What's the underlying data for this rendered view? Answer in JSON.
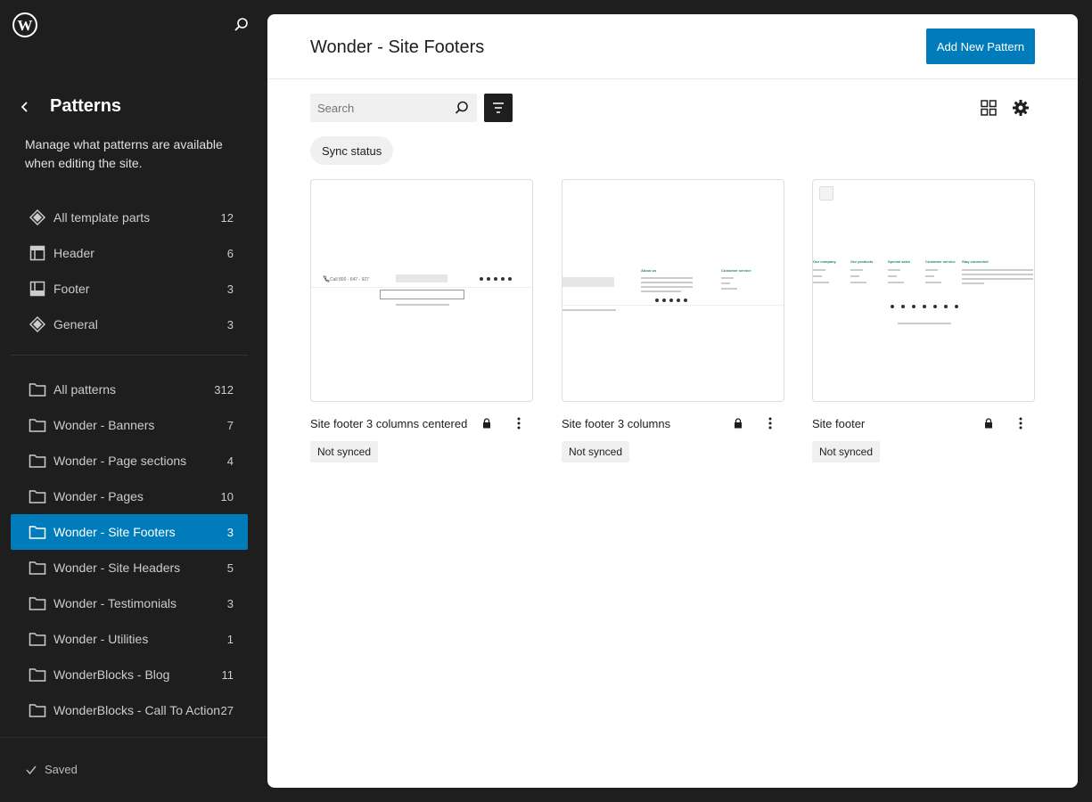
{
  "sidebar": {
    "logo_icon": "wordpress-logo-icon",
    "title": "Patterns",
    "description": "Manage what patterns are available when editing the site.",
    "template_parts": [
      {
        "label": "All template parts",
        "count": "12",
        "icon": "symbol-icon"
      },
      {
        "label": "Header",
        "count": "6",
        "icon": "header-icon"
      },
      {
        "label": "Footer",
        "count": "3",
        "icon": "footer-icon"
      },
      {
        "label": "General",
        "count": "3",
        "icon": "symbol-icon"
      }
    ],
    "categories": [
      {
        "label": "All patterns",
        "count": "312"
      },
      {
        "label": "Wonder - Banners",
        "count": "7"
      },
      {
        "label": "Wonder - Page sections",
        "count": "4"
      },
      {
        "label": "Wonder - Pages",
        "count": "10"
      },
      {
        "label": "Wonder - Site Footers",
        "count": "3",
        "active": true
      },
      {
        "label": "Wonder - Site Headers",
        "count": "5"
      },
      {
        "label": "Wonder - Testimonials",
        "count": "3"
      },
      {
        "label": "Wonder - Utilities",
        "count": "1"
      },
      {
        "label": "WonderBlocks - Blog",
        "count": "11"
      },
      {
        "label": "WonderBlocks - Call To Action",
        "count": "27"
      }
    ],
    "saved_label": "Saved"
  },
  "main": {
    "title": "Wonder - Site Footers",
    "add_button": "Add New Pattern",
    "search_placeholder": "Search",
    "filter_chip": "Sync status",
    "patterns": [
      {
        "title": "Site footer 3 columns centered",
        "status": "Not synced",
        "locked": true
      },
      {
        "title": "Site footer 3 columns",
        "status": "Not synced",
        "locked": true
      },
      {
        "title": "Site footer",
        "status": "Not synced",
        "locked": true
      }
    ]
  },
  "thumbs": {
    "t1_phone": "Call 800 - 647 - 927",
    "t2_about": "About us",
    "t2_service": "Customer service",
    "t3_cols": [
      "Our company",
      "Our products",
      "Special sales",
      "Customer service",
      "Stay connected"
    ]
  },
  "colors": {
    "accent": "#007cba",
    "sidebar_bg": "#1e1e1e",
    "thumb_heading": "#1a8a5a"
  }
}
